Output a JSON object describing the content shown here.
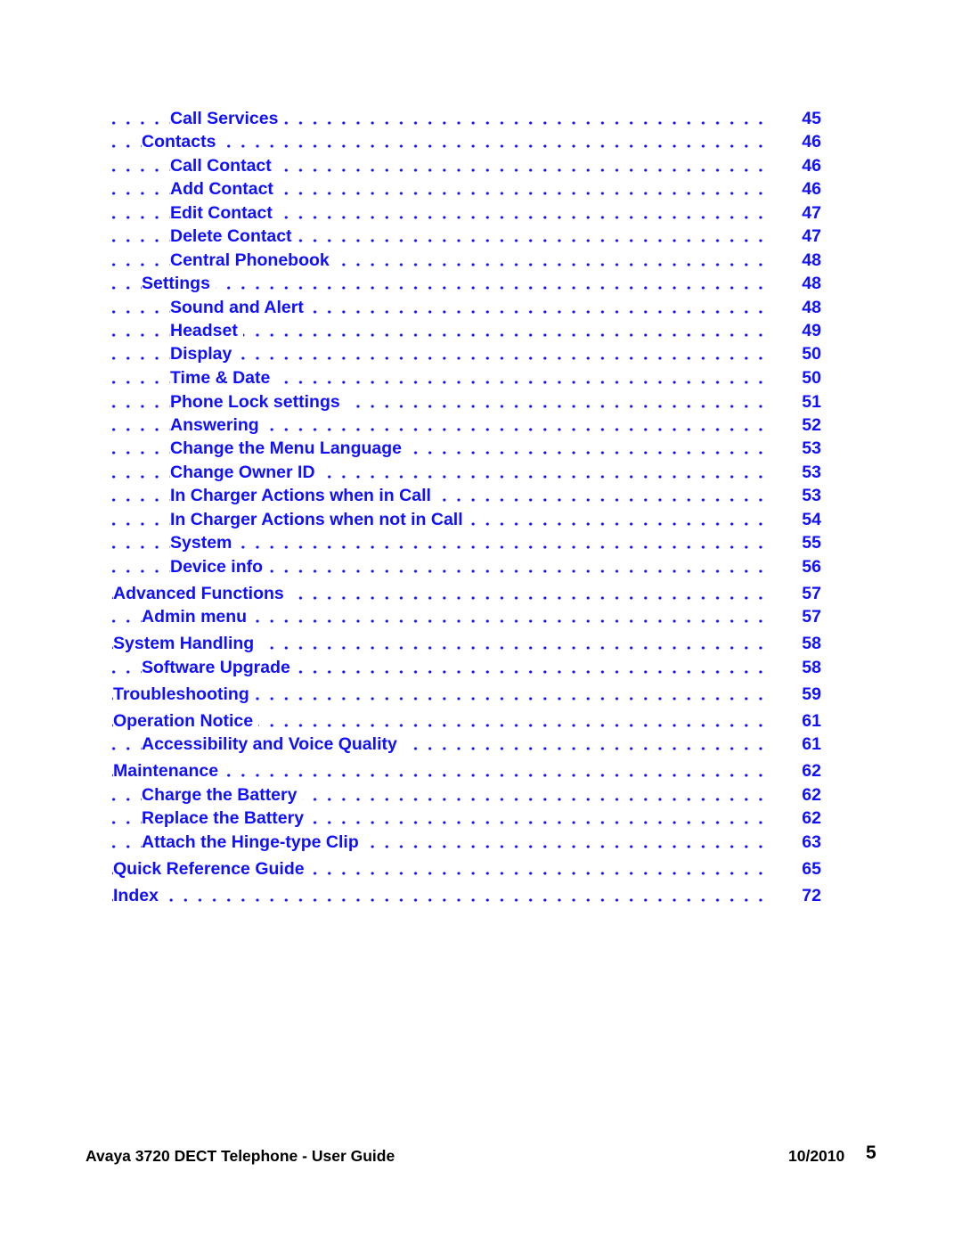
{
  "link_color": "#1010ff",
  "toc": [
    {
      "title": "Call Services",
      "page": "45",
      "level": 2
    },
    {
      "title": "Contacts",
      "page": "46",
      "level": 1
    },
    {
      "title": "Call Contact",
      "page": "46",
      "level": 2
    },
    {
      "title": "Add Contact",
      "page": "46",
      "level": 2
    },
    {
      "title": "Edit Contact",
      "page": "47",
      "level": 2
    },
    {
      "title": "Delete Contact",
      "page": "47",
      "level": 2
    },
    {
      "title": "Central Phonebook",
      "page": "48",
      "level": 2
    },
    {
      "title": "Settings",
      "page": "48",
      "level": 1
    },
    {
      "title": "Sound and Alert",
      "page": "48",
      "level": 2
    },
    {
      "title": "Headset",
      "page": "49",
      "level": 2
    },
    {
      "title": "Display",
      "page": "50",
      "level": 2
    },
    {
      "title": "Time & Date",
      "page": "50",
      "level": 2
    },
    {
      "title": "Phone Lock settings",
      "page": "51",
      "level": 2
    },
    {
      "title": "Answering",
      "page": "52",
      "level": 2
    },
    {
      "title": "Change the Menu Language",
      "page": "53",
      "level": 2
    },
    {
      "title": "Change Owner ID",
      "page": "53",
      "level": 2
    },
    {
      "title": "In Charger Actions when in Call",
      "page": "53",
      "level": 2
    },
    {
      "title": "In Charger Actions when not in Call",
      "page": "54",
      "level": 2
    },
    {
      "title": "System",
      "page": "55",
      "level": 2
    },
    {
      "title": "Device info",
      "page": "56",
      "level": 2
    },
    {
      "title": "Advanced Functions",
      "page": "57",
      "level": 0
    },
    {
      "title": "Admin menu",
      "page": "57",
      "level": 1
    },
    {
      "title": "System Handling",
      "page": "58",
      "level": 0
    },
    {
      "title": "Software Upgrade",
      "page": "58",
      "level": 1
    },
    {
      "title": "Troubleshooting",
      "page": "59",
      "level": 0
    },
    {
      "title": "Operation Notice",
      "page": "61",
      "level": 0
    },
    {
      "title": "Accessibility and Voice Quality",
      "page": "61",
      "level": 1
    },
    {
      "title": "Maintenance",
      "page": "62",
      "level": 0
    },
    {
      "title": "Charge the Battery",
      "page": "62",
      "level": 1
    },
    {
      "title": "Replace the Battery",
      "page": "62",
      "level": 1
    },
    {
      "title": "Attach the Hinge-type Clip",
      "page": "63",
      "level": 1
    },
    {
      "title": "Quick Reference Guide",
      "page": "65",
      "level": 0
    },
    {
      "title": "Index",
      "page": "72",
      "level": 0
    }
  ],
  "footer": {
    "doc_title": "Avaya 3720 DECT Telephone - User Guide",
    "date": "10/2010",
    "page_number": "5"
  }
}
